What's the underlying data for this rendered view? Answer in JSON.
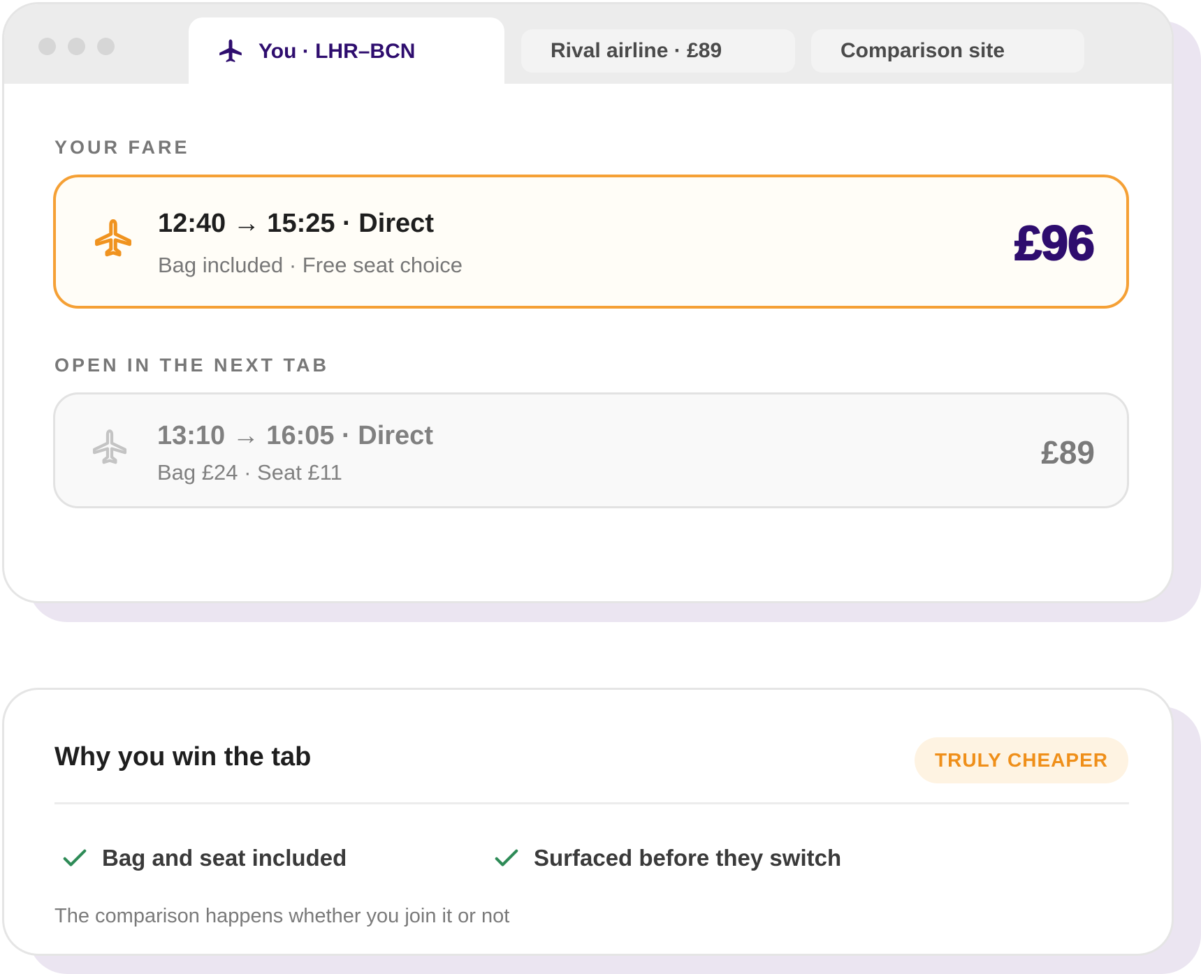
{
  "tabs": {
    "active": {
      "label": "You · LHR–BCN",
      "icon": "plane-icon"
    },
    "rival": {
      "label": "Rival airline · £89"
    },
    "comparison": {
      "label": "Comparison site"
    }
  },
  "your_fare": {
    "section_label": "YOUR FARE",
    "times": "12:40 → 15:25 · Direct",
    "extras": "Bag included · Free seat choice",
    "price": "£96",
    "icon": "plane-icon"
  },
  "next_tab": {
    "section_label": "OPEN IN THE NEXT TAB",
    "times": "13:10 → 16:05 · Direct",
    "extras": "Bag £24 · Seat £11",
    "price": "£89",
    "icon": "plane-icon"
  },
  "summary": {
    "title": "Why you win the tab",
    "badge": "TRULY CHEAPER",
    "perks": [
      {
        "label": "Bag and seat included",
        "icon": "check-icon"
      },
      {
        "label": "Surfaced before they switch",
        "icon": "check-icon"
      }
    ],
    "footnote": "The comparison happens whether you join it or not"
  },
  "colors": {
    "brand": "#2e0d6e",
    "accent": "#f5a035",
    "badge_text": "#ef8f1a",
    "check": "#2e8b57"
  }
}
